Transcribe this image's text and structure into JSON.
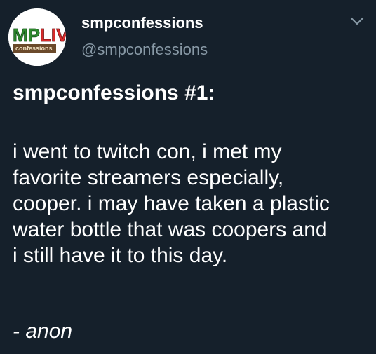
{
  "author": {
    "display_name": "smpconfessions",
    "handle": "@smpconfessions",
    "avatar_logo_text": "MPLIV",
    "avatar_subtitle_text": "confessions"
  },
  "menu": {
    "icon": "chevron-down-icon"
  },
  "tweet": {
    "title": "smpconfessions #1:",
    "body_lines": [
      "i went to twitch con, i met my",
      "favorite streamers especially,",
      "cooper. i may have taken a plastic",
      "water bottle that was coopers and",
      "i still have it to this day."
    ],
    "signoff": "- anon"
  },
  "colors": {
    "background": "#15202b",
    "text_primary": "#ffffff",
    "text_secondary": "#8899a6",
    "logo_green": "#2e8b2e",
    "logo_red": "#d92b2b"
  }
}
